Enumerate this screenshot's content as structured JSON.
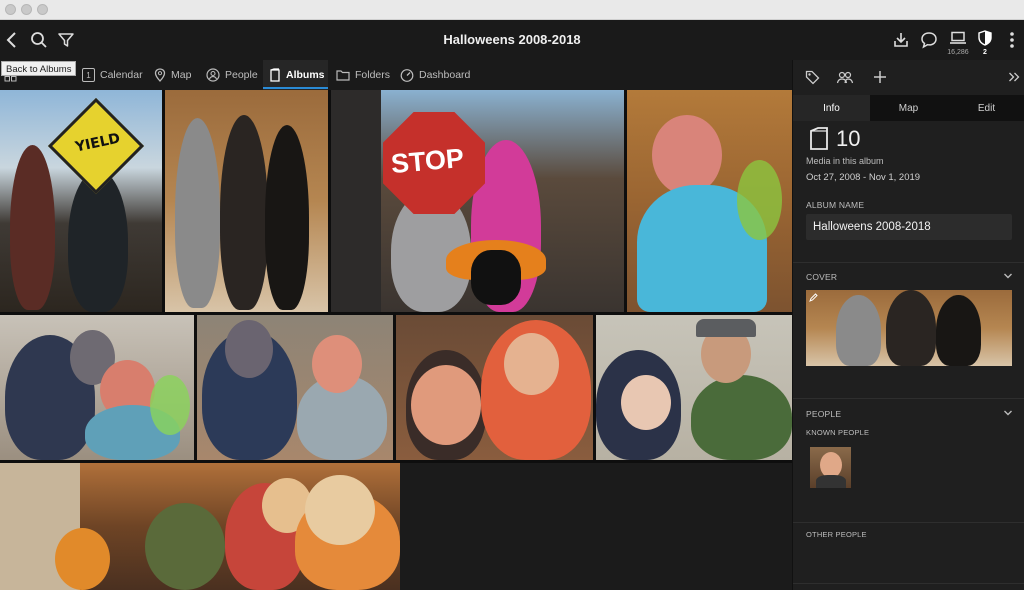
{
  "window": {
    "title": "Halloweens 2008-2018"
  },
  "toolbar": {
    "back_icon": "chevron-left-icon",
    "search_icon": "search-icon",
    "filter_icon": "filter-icon",
    "library_count": "16,286",
    "badge_count": "2"
  },
  "tooltip": {
    "text": "Back to Albums"
  },
  "nav": {
    "tabs": [
      {
        "label": "Calendar",
        "icon": "calendar-icon"
      },
      {
        "label": "Map",
        "icon": "map-pin-icon"
      },
      {
        "label": "People",
        "icon": "person-icon"
      },
      {
        "label": "Albums",
        "icon": "album-icon"
      },
      {
        "label": "Folders",
        "icon": "folder-icon"
      },
      {
        "label": "Dashboard",
        "icon": "gauge-icon"
      }
    ],
    "active": "Albums",
    "calendar_number": "1"
  },
  "photos": {
    "count": 10
  },
  "panel": {
    "tabs": [
      "Info",
      "Map",
      "Edit"
    ],
    "active_tab": "Info",
    "media_count": "10",
    "media_label": "Media in this album",
    "date_range": "Oct 27, 2008 - Nov 1, 2019",
    "album_name_label": "ALBUM NAME",
    "album_name": "Halloweens 2008-2018",
    "cover_label": "COVER",
    "people_label": "PEOPLE",
    "known_people_label": "KNOWN PEOPLE",
    "other_people_label": "OTHER PEOPLE"
  },
  "colors": {
    "accent": "#2a8bd6",
    "background": "#1b1b1b"
  }
}
